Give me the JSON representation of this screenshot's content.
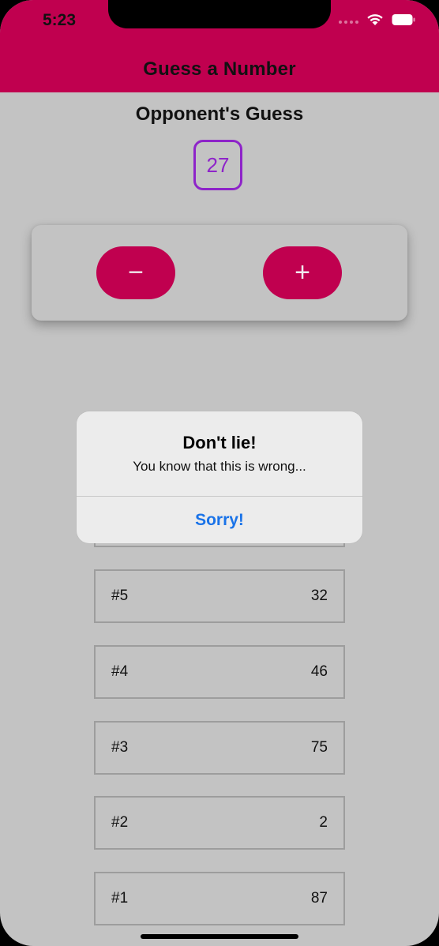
{
  "status_bar": {
    "time": "5:23",
    "icons": [
      "signal-icon",
      "wifi-icon",
      "battery-icon"
    ]
  },
  "header": {
    "title": "Guess a Number",
    "color": "#c0004f"
  },
  "main": {
    "opponent_title": "Opponent's Guess",
    "current_guess": "27",
    "controls": {
      "minus_label": "−",
      "plus_label": "+"
    },
    "history": [
      {
        "label": "#5",
        "value": "32"
      },
      {
        "label": "#4",
        "value": "46"
      },
      {
        "label": "#3",
        "value": "75"
      },
      {
        "label": "#2",
        "value": "2"
      },
      {
        "label": "#1",
        "value": "87"
      }
    ]
  },
  "alert": {
    "title": "Don't lie!",
    "message": "You know that this is wrong...",
    "button_label": "Sorry!"
  },
  "colors": {
    "accent": "#c0004f",
    "guess_border": "#8e24c9",
    "alert_button": "#1a73e8",
    "background": "#c3c3c3"
  }
}
